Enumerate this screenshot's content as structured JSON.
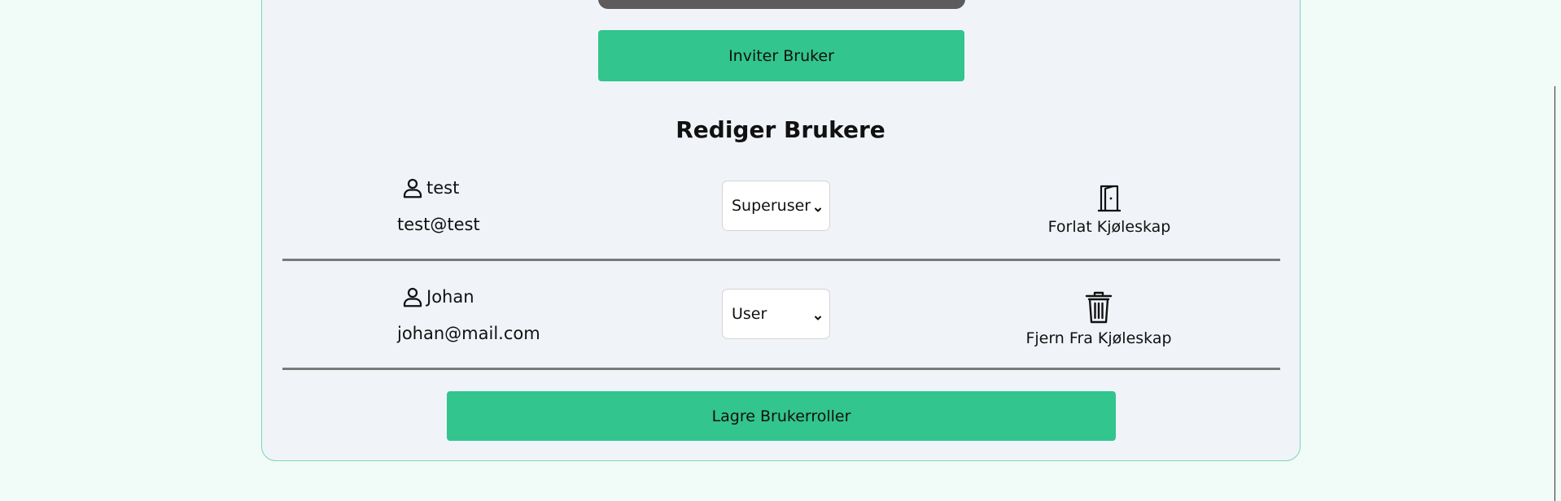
{
  "invite": {
    "label": "Inviter Bruker"
  },
  "section": {
    "title": "Rediger Brukere"
  },
  "users": [
    {
      "name": "test",
      "email": "test@test",
      "role": "Superuser",
      "action_label": "Forlat Kjøleskap",
      "action_icon": "door-icon"
    },
    {
      "name": "Johan",
      "email": "johan@mail.com",
      "role": "User",
      "action_label": "Fjern Fra Kjøleskap",
      "action_icon": "trash-icon"
    }
  ],
  "save": {
    "label": "Lagre Brukerroller"
  },
  "colors": {
    "accent": "#32c58d",
    "card_bg": "#f0f4f9",
    "page_bg": "#f1fbf7",
    "card_border": "#7fd5b1",
    "dark_bar": "#5d5b5b"
  }
}
